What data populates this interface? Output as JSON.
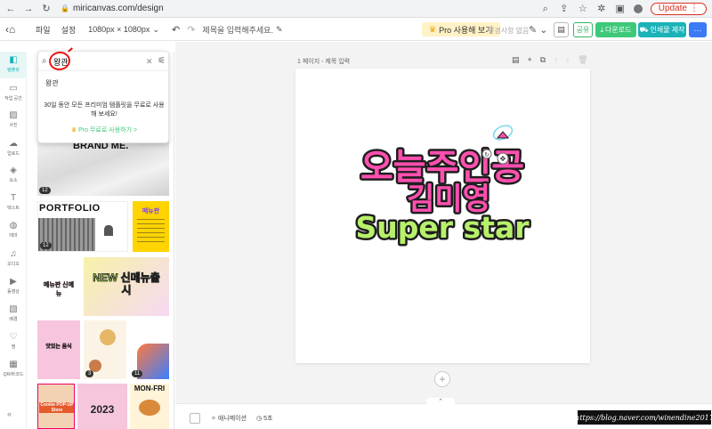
{
  "browser": {
    "url": "miricanvas.com/design",
    "update_label": "Update"
  },
  "header": {
    "menu_file": "파일",
    "menu_settings": "설정",
    "size": "1080px × 1080px",
    "title_placeholder": "제목을 입력해주세요.",
    "pro_label": "Pro 사용해 보기",
    "history_label": "변경사항 없음",
    "share_label": "공유",
    "download_label": "다운로드",
    "print_label": "인쇄물 제작",
    "colors": {
      "green": "#3ec97a",
      "teal": "#19b3b8",
      "blue": "#3b7bf6",
      "pro_bg": "#fff2c6"
    }
  },
  "rail": {
    "items": [
      {
        "label": "템플릿",
        "icon": "template-icon"
      },
      {
        "label": "작업 공간",
        "icon": "folder-icon"
      },
      {
        "label": "사진",
        "icon": "photo-icon"
      },
      {
        "label": "업로드",
        "icon": "upload-icon"
      },
      {
        "label": "요소",
        "icon": "elements-icon"
      },
      {
        "label": "텍스트",
        "icon": "text-icon"
      },
      {
        "label": "테마",
        "icon": "palette-icon"
      },
      {
        "label": "오디오",
        "icon": "music-icon"
      },
      {
        "label": "동영상",
        "icon": "video-icon"
      },
      {
        "label": "배경",
        "icon": "background-icon"
      },
      {
        "label": "찜",
        "icon": "heart-icon"
      },
      {
        "label": "QR/바코드",
        "icon": "qr-icon"
      }
    ]
  },
  "search": {
    "value": "왕관",
    "suggestion": "왕관",
    "promo": "30일 동안 모든 프리미엄 템플릿을 무료로 사용해 보세요!",
    "promo_link": "Pro 무료로 사용하기 >"
  },
  "templates": {
    "brand_text": "BRAND ME.",
    "brand_count": "12",
    "portfolio_text": "PORTFOLIO",
    "portfolio_count": "12",
    "menu_text": "메뉴판",
    "new_menu_text": "NEW 신메뉴출시",
    "left_sticker_text": "메뉴판 신메뉴",
    "pink_text": "맛있는 음식",
    "food_count": "3",
    "grad_count": "11",
    "cookie_text": "Cookie POP-UP Store",
    "year_text": "2023",
    "monfri_text": "MON-FRI"
  },
  "canvas": {
    "page_label": "1 페이지 - 제목 입력",
    "art_line1": "오늘주인공",
    "art_line2": "김미영",
    "art_line3": "Super star"
  },
  "bottom": {
    "animation_label": "애니메이션",
    "time_label": "5초"
  },
  "watermark": "https://blog.naver.com/winendine2017"
}
